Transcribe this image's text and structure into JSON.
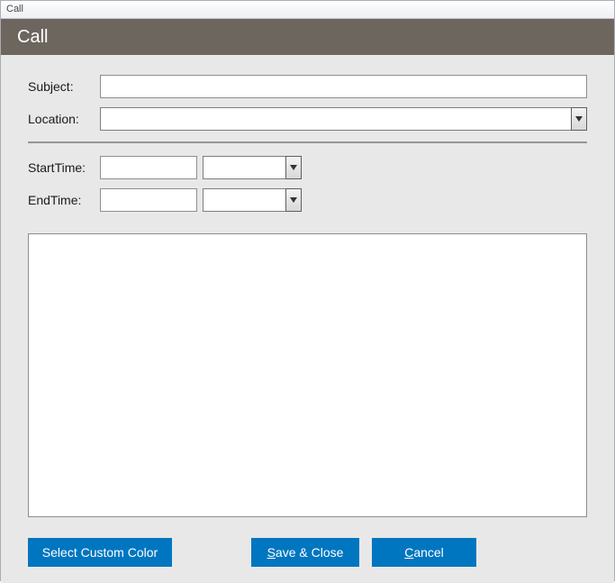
{
  "window": {
    "title": "Call"
  },
  "header": {
    "title": "Call"
  },
  "form": {
    "subject_label": "Subject:",
    "subject_value": "",
    "location_label": "Location:",
    "location_value": "",
    "starttime_label": "StartTime:",
    "startdate_value": "",
    "starttime_value": "",
    "endtime_label": "EndTime:",
    "enddate_value": "",
    "endtime_value2": "",
    "notes_value": ""
  },
  "buttons": {
    "custom_color": "Select Custom Color",
    "save_prefix": "S",
    "save_rest": "ave & Close",
    "cancel_prefix": "C",
    "cancel_rest": "ancel"
  }
}
